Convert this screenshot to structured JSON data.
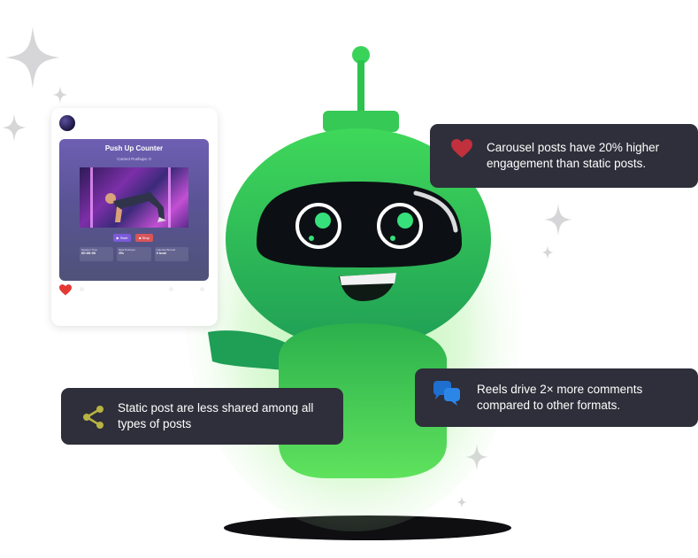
{
  "post": {
    "media_title": "Push Up Counter",
    "media_subtitle": "Correct Pushups: 0",
    "start_label": "▶ Start",
    "stop_label": "■ Stop",
    "stats": [
      {
        "label": "Session Time",
        "value": "00:00:00"
      },
      {
        "label": "Best Pushups",
        "value": "0%"
      },
      {
        "label": "Calories Burned",
        "value": "0 kcal"
      }
    ]
  },
  "insights": [
    {
      "icon": "heart-icon",
      "text": "Carousel posts have 20% higher engagement than static posts.",
      "icon_color": "#c0303d"
    },
    {
      "icon": "share-icon",
      "text": "Static post are less shared among all types of posts",
      "icon_color": "#b8b342"
    },
    {
      "icon": "chat-bubbles-icon",
      "text": "Reels drive 2× more comments compared to other formats.",
      "icon_color": "#1f6fcf"
    }
  ],
  "colors": {
    "robot_green": "#2fbf4a",
    "card_bg": "#2e2f3a",
    "glow": "#5be35a"
  }
}
